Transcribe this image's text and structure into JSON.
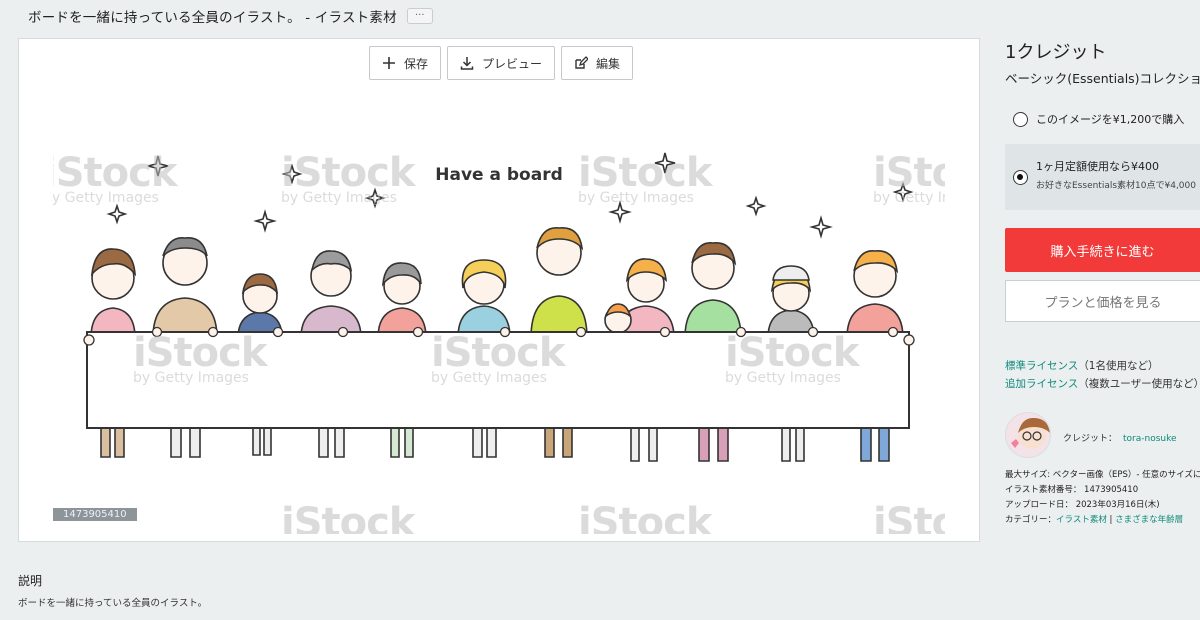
{
  "page": {
    "title": "ボードを一緒に持っている全員のイラスト。 - イラスト素材",
    "more_label": "···"
  },
  "toolbar": {
    "save_label": "保存",
    "preview_label": "プレビュー",
    "edit_label": "編集"
  },
  "image": {
    "heading_text": "Have a board",
    "watermark_brand": "iStock",
    "watermark_sub": "by Getty Images",
    "asset_id": "1473905410",
    "accent_colors": [
      "#f3b7c2",
      "#f6cf5a",
      "#cfe14a",
      "#9ad0e0",
      "#f3a19b"
    ]
  },
  "description": {
    "heading": "説明",
    "text": "ボードを一緒に持っている全員のイラスト。"
  },
  "purchase": {
    "credit_title": "1クレジット",
    "collection": "ベーシック(Essentials)コレクション",
    "option1": "このイメージを¥1,200で購入",
    "option2_main": "1ヶ月定額使用なら¥400",
    "option2_sub": "お好きなEssentials素材10点で¥4,000",
    "buy_button": "購入手続きに進む",
    "plans_button": "プランと価格を見る"
  },
  "license": {
    "standard_link": "標準ライセンス",
    "standard_note": "（1名使用など）",
    "extended_link": "追加ライセンス",
    "extended_note": "（複数ユーザー使用など）"
  },
  "contributor": {
    "label": "クレジット：",
    "name": "tora-nosuke"
  },
  "metadata": {
    "max_size": "最大サイズ: ベクター画像（EPS）- 任意のサイズに拡大縮小",
    "asset_number": "イラスト素材番号： 1473905410",
    "upload_date": "アップロード日： 2023年03月16日(木)",
    "category_label": "カテゴリー：",
    "category_1": "イラスト素材",
    "category_sep": " | ",
    "category_2": "さまざまな年齢層"
  },
  "colors": {
    "buy_button": "#f33a3a",
    "link": "#0d8a7a",
    "selected_option_bg": "#dfe5e7"
  }
}
